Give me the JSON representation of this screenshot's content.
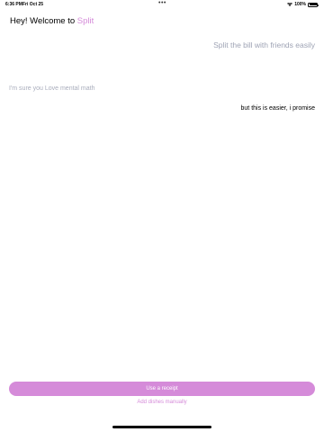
{
  "status_bar": {
    "time": "6:36 PM",
    "date": "Fri Oct 25",
    "multitasking": "•••",
    "battery_percent": "100%",
    "icons": [
      "wifi-icon",
      "battery-icon"
    ]
  },
  "welcome": {
    "prefix": "Hey! Welcome to ",
    "brand": "Split"
  },
  "tagline": "Split the bill with friends easily",
  "mental_math": "I'm sure you Love mental math",
  "promise": "but this is easier, i promise",
  "actions": {
    "receipt_label": "Use a receipt",
    "manual_label": "Add dishes manually"
  },
  "colors": {
    "accent": "#d58bd9",
    "muted_text": "#9ea3b4",
    "background": "#ffffff",
    "text": "#000000"
  }
}
